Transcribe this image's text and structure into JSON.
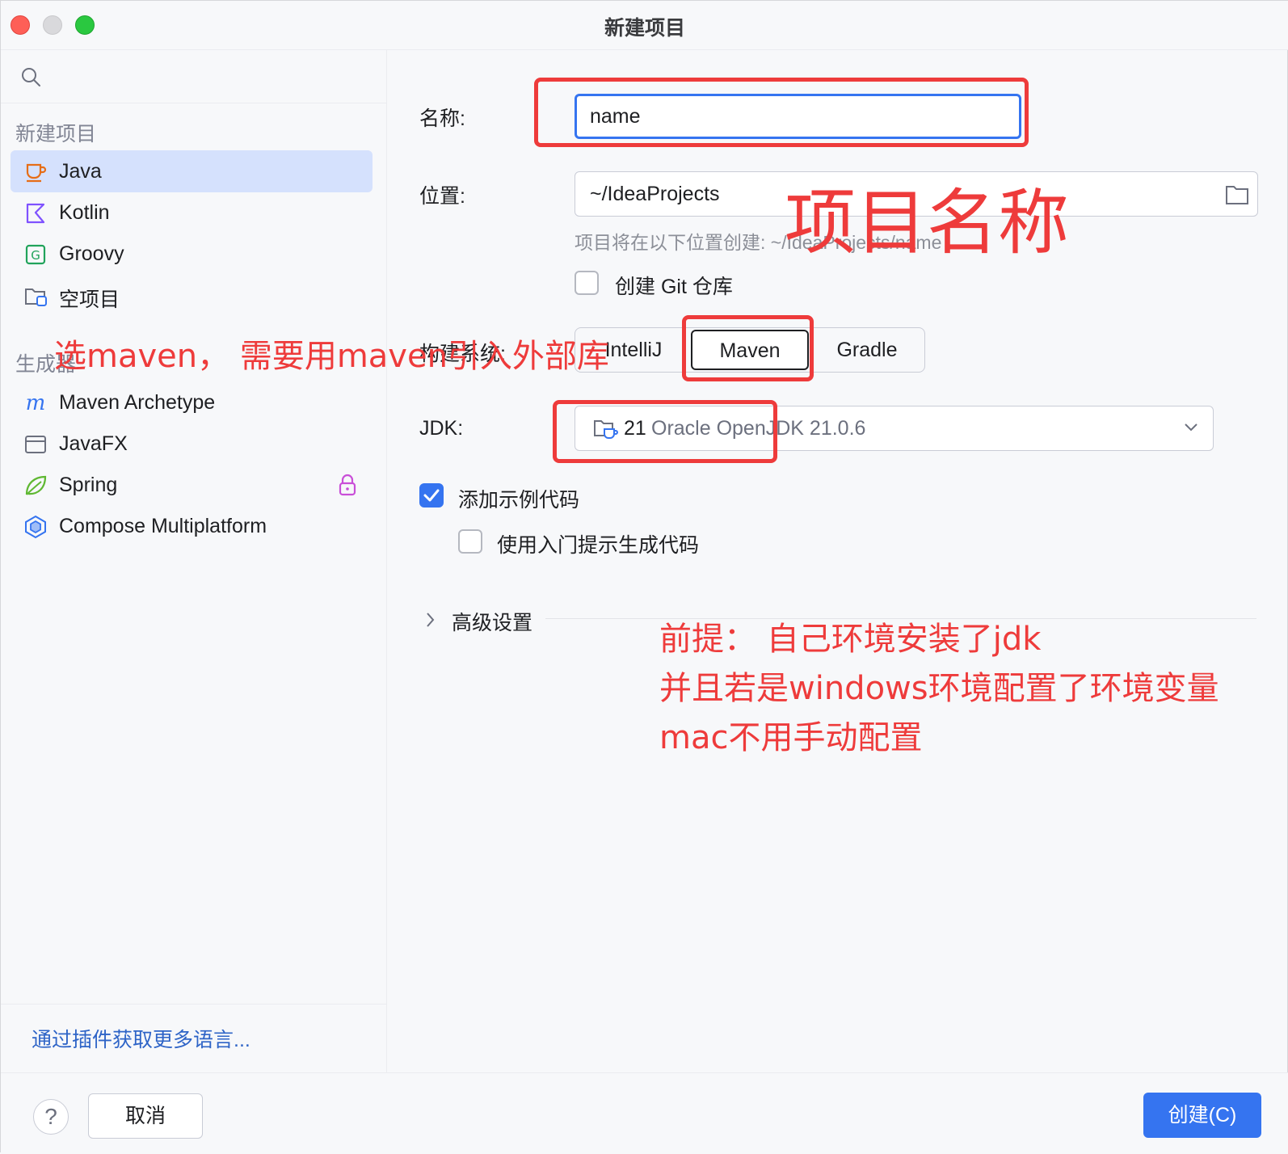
{
  "window": {
    "title": "新建项目"
  },
  "sidebar": {
    "search": {
      "placeholder": "",
      "value": ""
    },
    "groups": [
      {
        "title": "新建项目"
      },
      {
        "title": "生成器"
      }
    ],
    "items": [
      {
        "label": "Java",
        "icon": "java-cup-icon",
        "selected": true
      },
      {
        "label": "Kotlin",
        "icon": "kotlin-icon"
      },
      {
        "label": "Groovy",
        "icon": "groovy-icon"
      },
      {
        "label": "空项目",
        "icon": "empty-project-icon"
      },
      {
        "label": "Maven Archetype",
        "icon": "maven-icon"
      },
      {
        "label": "JavaFX",
        "icon": "javafx-window-icon"
      },
      {
        "label": "Spring",
        "icon": "spring-leaf-icon",
        "locked": true
      },
      {
        "label": "Compose Multiplatform",
        "icon": "compose-hexagon-icon"
      }
    ],
    "plugins_link": "通过插件获取更多语言..."
  },
  "form": {
    "name_label": "名称:",
    "name_value": "name",
    "location_label": "位置:",
    "location_value": "~/IdeaProjects",
    "location_hint": "项目将在以下位置创建: ~/IdeaProjects/name",
    "git_label": "创建 Git 仓库",
    "git_checked": false,
    "build_label": "构建系统:",
    "build_options": [
      "IntelliJ",
      "Maven",
      "Gradle"
    ],
    "build_selected": "Maven",
    "jdk_label": "JDK:",
    "jdk_version": "21",
    "jdk_desc": "Oracle OpenJDK 21.0.6",
    "sample_label": "添加示例代码",
    "sample_checked": true,
    "onboarding_label": "使用入门提示生成代码",
    "onboarding_checked": false,
    "advanced_label": "高级设置"
  },
  "footer": {
    "help_label": "?",
    "cancel_label": "取消",
    "create_label": "创建(C)"
  },
  "annotations": {
    "project_name": "项目名称",
    "choose_maven": "选maven， 需要用maven引入外部库",
    "note_line1": "前提： 自己环境安装了jdk",
    "note_line2": "并且若是windows环境配置了环境变量",
    "note_line3": "mac不用手动配置"
  },
  "colors": {
    "accent": "#3574f0",
    "selection": "#d5e1fd",
    "annotation_red": "#ee3b3b",
    "link": "#2e64c7"
  }
}
